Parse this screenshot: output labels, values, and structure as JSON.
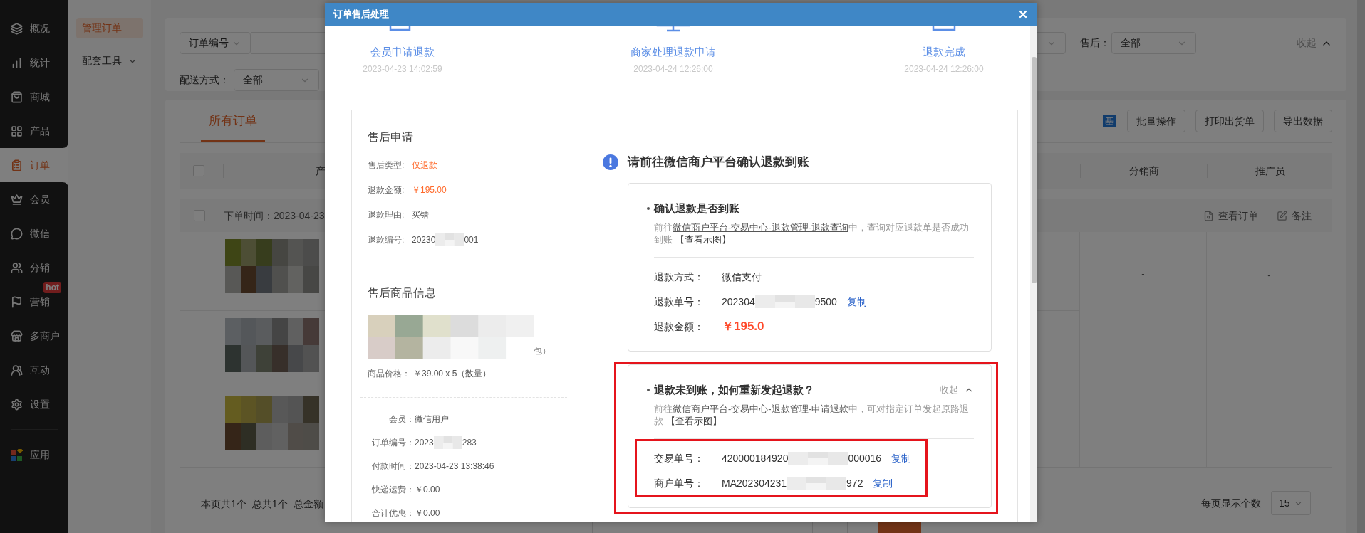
{
  "sidebar": {
    "items": [
      {
        "label": "概况",
        "selected": false
      },
      {
        "label": "统计",
        "selected": false
      },
      {
        "label": "商城",
        "selected": false
      },
      {
        "label": "产品",
        "selected": false
      },
      {
        "label": "订单",
        "selected": true
      },
      {
        "label": "会员",
        "selected": false
      },
      {
        "label": "微信",
        "selected": false
      },
      {
        "label": "分销",
        "selected": false
      },
      {
        "label": "营销",
        "selected": false,
        "badge": "hot"
      },
      {
        "label": "多商户",
        "selected": false
      },
      {
        "label": "互动",
        "selected": false
      },
      {
        "label": "设置",
        "selected": false
      }
    ],
    "apps": {
      "label": "应用",
      "selected": false
    }
  },
  "subnav": [
    {
      "label": "管理订单",
      "selected": true,
      "has_menu": false
    },
    {
      "label": "配套工具",
      "selected": false,
      "has_menu": true
    }
  ],
  "filters": {
    "search_type": "订单编号",
    "after_sale_label": "售后：",
    "after_sale_value": "全部",
    "collapse": "收起",
    "shipping_label": "配送方式：",
    "shipping_value": "全部"
  },
  "orders": {
    "tabs": [
      {
        "label": "所有订单",
        "selected": true
      }
    ],
    "tag": "基",
    "buttons": [
      "批量操作",
      "打印出货单",
      "导出数据"
    ],
    "columns": [
      "产",
      "分销商",
      "推广员"
    ],
    "header_checkbox": {
      "checked": false
    },
    "group": {
      "checked": false,
      "time": "下单时间：2023-04-23",
      "actions": [
        "查看订单",
        "备注"
      ],
      "distributor": "-",
      "promoter": "-"
    },
    "summary": [
      "本页共1个",
      "总共1个",
      "总金额"
    ],
    "page_size_label": "每页显示个数",
    "page_size": "15"
  },
  "modal": {
    "title": "订单售后处理",
    "steps": [
      {
        "title": "会员申请退款",
        "time": "2023-04-23 14:02:59"
      },
      {
        "title": "商家处理退款申请",
        "time": "2023-04-24 12:26:00"
      },
      {
        "title": "退款完成",
        "time": "2023-04-24 12:26:00"
      }
    ],
    "application": {
      "title": "售后申请",
      "fields": [
        {
          "kind": "accent",
          "label": "售后类型:",
          "value": "仅退款"
        },
        {
          "kind": "accent",
          "label": "退款金额:",
          "value": "￥195.00"
        },
        {
          "kind": "plain",
          "label": "退款理由:",
          "value": "买错"
        },
        {
          "kind": "redacted",
          "label": "退款编号:",
          "parts": [
            "20230",
            "001"
          ]
        }
      ]
    },
    "goods": {
      "title": "售后商品信息",
      "name_tail": "包）",
      "price_label": "商品价格：",
      "price": "￥39.00 x 5（数量）"
    },
    "order_fields": [
      {
        "kind": "plain",
        "label": "会员：",
        "value": "微信用户"
      },
      {
        "kind": "redacted",
        "label": "订单编号：",
        "parts": [
          "2023",
          "283"
        ]
      },
      {
        "kind": "plain",
        "label": "付款时间：",
        "value": "2023-04-23 13:38:46"
      },
      {
        "kind": "plain",
        "label": "快递运费：",
        "value": "￥0.00"
      },
      {
        "kind": "plain",
        "label": "合计优惠：",
        "value": "￥0.00"
      }
    ],
    "notice": "请前往微信商户平台确认退款到账",
    "cards": [
      {
        "title": "确认退款是否到账",
        "highlighted": false,
        "rows_highlighted": false,
        "desc_before": "前往",
        "desc_link": "微信商户平台-交易中心-退款管理-退款查询",
        "desc_after": "中，查询对应退款单是否成功到账",
        "example_link": "【查看示图】",
        "rows": [
          {
            "kind": "plain",
            "label": "退款方式：",
            "value": "微信支付"
          },
          {
            "kind": "redacted",
            "label": "退款单号：",
            "parts": [
              "202304",
              "9500"
            ],
            "copy": "复制"
          },
          {
            "kind": "amount",
            "label": "退款金额：",
            "value": "￥195.0"
          }
        ]
      },
      {
        "title": "退款未到账，如何重新发起退款？",
        "toggle": "收起",
        "expanded": true,
        "highlighted": true,
        "rows_highlighted": true,
        "desc_before": "前往",
        "desc_link": "微信商户平台-交易中心-退款管理-申请退款",
        "desc_after": "中，可对指定订单发起原路退款",
        "example_link": "【查看示图】",
        "rows": [
          {
            "kind": "redacted",
            "label": "交易单号：",
            "parts": [
              "420000184920",
              "000016"
            ],
            "copy": "复制"
          },
          {
            "kind": "redacted",
            "label": "商户单号：",
            "parts": [
              "MA202304231",
              "972"
            ],
            "copy": "复制"
          }
        ]
      }
    ]
  }
}
